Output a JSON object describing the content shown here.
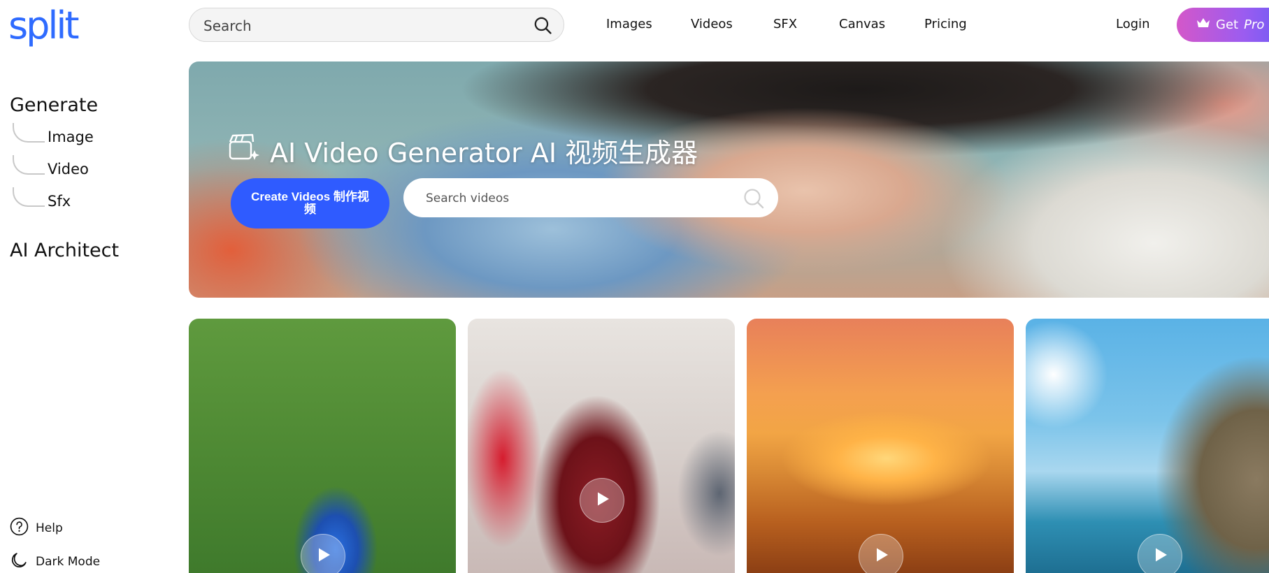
{
  "brand": {
    "logo_text": "split",
    "color": "#2f6bff"
  },
  "sidebar": {
    "generate_title": "Generate",
    "items": [
      {
        "label": "Image"
      },
      {
        "label": "Video"
      },
      {
        "label": "Sfx"
      }
    ],
    "architect_title": "AI Architect",
    "help_label": "Help",
    "darkmode_label": "Dark Mode"
  },
  "header": {
    "search_placeholder": "Search",
    "nav": [
      {
        "label": "Images"
      },
      {
        "label": "Videos"
      },
      {
        "label": "SFX"
      },
      {
        "label": "Canvas"
      },
      {
        "label": "Pricing"
      }
    ],
    "login_label": "Login",
    "getpro": {
      "get": "Get",
      "pro": "Pro"
    }
  },
  "hero": {
    "title": "AI Video Generator  AI 视频生成器",
    "create_button": "Create Videos  制作视频",
    "search_placeholder": "Search videos"
  },
  "icons": {
    "search": "search-icon",
    "clapper": "clapperboard-sparkle-icon",
    "help": "help-circle-icon",
    "moon": "moon-icon",
    "crown": "crown-icon",
    "play": "play-icon"
  },
  "colors": {
    "accent": "#2f5bff",
    "pro_gradient_start": "#d457c9",
    "pro_gradient_end": "#6a5cf5"
  }
}
